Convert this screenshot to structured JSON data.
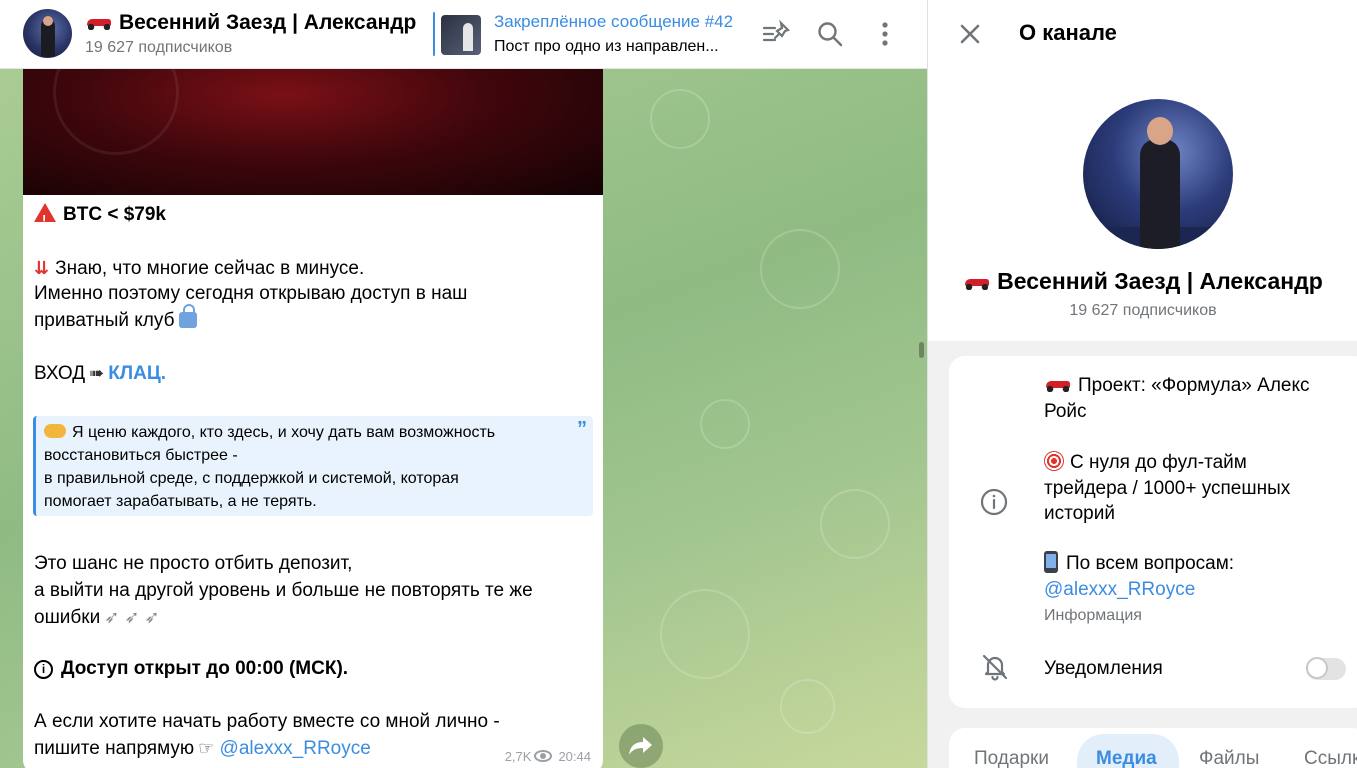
{
  "header": {
    "channel_name": "Весенний Заезд | Александр",
    "subscribers": "19 627 подписчиков",
    "pinned_title": "Закреплённое сообщение #42",
    "pinned_text": "Пост про одно из направлен..."
  },
  "message": {
    "line1": "BTC < $79k",
    "line2": "Знаю, что многие сейчас в минусе.",
    "line3": "Именно поэтому сегодня открываю доступ в наш",
    "line4": "приватный клуб",
    "line5_prefix": "ВХОД",
    "line5_link": "КЛАЦ.",
    "quote": [
      "Я ценю каждого, кто здесь, и хочу дать вам возможность",
      "восстановиться быстрее -",
      "в правильной среде, с поддержкой и системой, которая",
      "помогает зарабатывать, а не терять."
    ],
    "line6": "Это шанс не просто отбить депозит,",
    "line7": "а выйти на другой уровень и больше не повторять те же",
    "line8": "ошибки",
    "line9": "Доступ открыт до 00:00 (МСК).",
    "line10": "А если хотите начать работу вместе со мной лично -",
    "line11_prefix": "пишите напрямую",
    "line11_link": "@alexxx_RRoyce",
    "views": "2,7K",
    "time": "20:44"
  },
  "info_panel": {
    "title": "О канале",
    "name": "Весенний Заезд | Александр",
    "subscribers": "19 627 подписчиков",
    "desc1": "Проект: «Формула» Алекс",
    "desc2": "Ройс",
    "desc3": "С нуля до фул-тайм",
    "desc4": "трейдера / 1000+ успешных",
    "desc5": "историй",
    "desc6": "По всем вопросам:",
    "desc7": "@alexxx_RRoyce",
    "info_label": "Информация",
    "notifications": "Уведомления",
    "notifications_on": false
  },
  "tabs": [
    "Подарки",
    "Медиа",
    "Файлы",
    "Ссылки"
  ],
  "active_tab": "Медиа",
  "colors": {
    "accent": "#3a8de0",
    "secondary_text": "#707579",
    "chat_bg": "#a9cc94"
  }
}
